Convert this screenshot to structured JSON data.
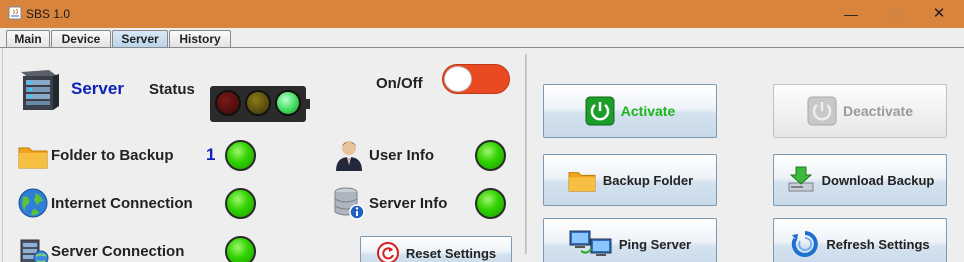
{
  "window": {
    "title": "SBS 1.0",
    "controls": {
      "minimize": "—",
      "maximize": "☐",
      "close": "✕"
    }
  },
  "tabs": [
    {
      "label": "Main",
      "active": false
    },
    {
      "label": "Device",
      "active": false
    },
    {
      "label": "Server",
      "active": true
    },
    {
      "label": "History",
      "active": false
    }
  ],
  "left_panel": {
    "server_title": "Server",
    "status_label": "Status",
    "onoff_label": "On/Off",
    "folder_label": "Folder to Backup",
    "folder_count": "1",
    "user_info_label": "User Info",
    "internet_label": "Internet Connection",
    "server_info_label": "Server Info",
    "server_conn_label": "Server Connection",
    "reset_button": "Reset Settings"
  },
  "right_panel": {
    "activate": "Activate",
    "deactivate": "Deactivate",
    "backup_folder": "Backup Folder",
    "download_backup": "Download Backup",
    "ping_server": "Ping Server",
    "refresh_settings": "Refresh Settings"
  },
  "colors": {
    "titlebar": "#d9843c",
    "accent_blue": "#0f22b8",
    "led_green": "#2fd200",
    "toggle_off": "#e94a22",
    "activate_green": "#1bb51b"
  }
}
